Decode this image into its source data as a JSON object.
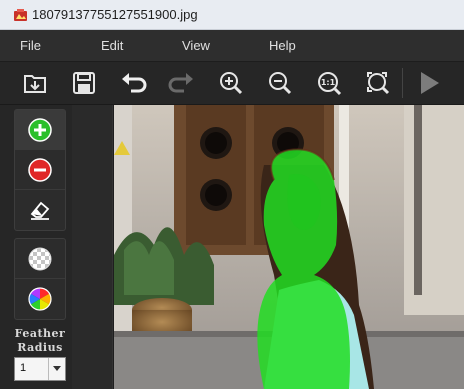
{
  "window": {
    "title": "18079137755127551900.jpg"
  },
  "menu": {
    "file": "File",
    "edit": "Edit",
    "view": "View",
    "help": "Help"
  },
  "toolbar": {
    "icons": [
      "open-icon",
      "save-icon",
      "undo-icon",
      "redo-icon",
      "zoom-in-icon",
      "zoom-out-icon",
      "actual-size-icon",
      "fit-to-window-icon",
      "play-icon"
    ],
    "actual_size_label": "1:1"
  },
  "tools": {
    "icons": [
      "add-green-icon",
      "remove-red-icon",
      "eraser-icon",
      "transparency-icon",
      "color-wheel-icon"
    ]
  },
  "feather": {
    "label_line1": "Feather",
    "label_line2": "Radius",
    "value": "1"
  },
  "colors": {
    "titlebar": "#e8ecf2",
    "menubar": "#2e2e2e",
    "toolbar": "#262626",
    "accent_add": "#2bbf2b",
    "accent_remove": "#e02626",
    "overlay": "#22dd22"
  }
}
